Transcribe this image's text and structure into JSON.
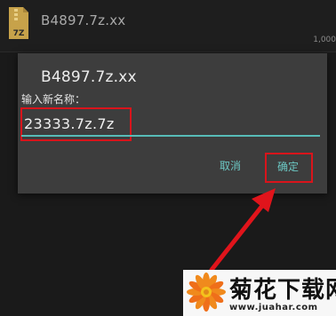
{
  "file_list": {
    "file_name": "B4897.7z.xx",
    "file_size": "1,000",
    "icon": "zip-archive-icon",
    "icon_label": "7Z"
  },
  "rename_dialog": {
    "title": "B4897.7z.xx",
    "label": "输入新名称：",
    "input_value": "23333.7z.7z",
    "cancel_label": "取消",
    "ok_label": "确定"
  },
  "watermark": {
    "title": "菊花下载网",
    "url": "www.juahar.com"
  },
  "colors": {
    "background": "#1a1a1a",
    "dialog": "#3d3d3d",
    "accent": "#57bcb8",
    "highlight": "#d9141b"
  }
}
